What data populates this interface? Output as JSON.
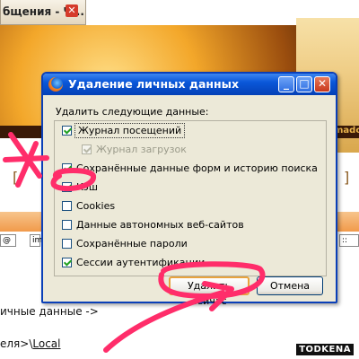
{
  "background": {
    "tab_title": "бщения - Ч...",
    "tab_close": "✕",
    "brand_fragment": "mado",
    "left_bracket": "[",
    "right_bracket": "]",
    "field_a": "@",
    "field_b": "im",
    "field_c": "::",
    "text_line_1": "ичные данные   ->",
    "text_line_2_prefix": "еля>\\",
    "text_line_2_link": "Local",
    "watermark": "TODKENA"
  },
  "dialog": {
    "title": "Удаление личных данных",
    "prompt": "Удалить следующие данные:",
    "options": [
      {
        "label": "Журнал посещений",
        "checked": true,
        "disabled": false
      },
      {
        "label": "Журнал загрузок",
        "checked": true,
        "disabled": true
      },
      {
        "label": "Сохранённые данные форм и историю поиска",
        "checked": true,
        "disabled": false
      },
      {
        "label": "Кэш",
        "checked": true,
        "disabled": false
      },
      {
        "label": "Cookies",
        "checked": false,
        "disabled": false
      },
      {
        "label": "Данные автономных веб-сайтов",
        "checked": false,
        "disabled": false
      },
      {
        "label": "Сохранённые пароли",
        "checked": false,
        "disabled": false
      },
      {
        "label": "Сессии аутентификации",
        "checked": true,
        "disabled": false
      }
    ],
    "buttons": {
      "delete": "Удалить сейчас",
      "cancel": "Отмена"
    }
  },
  "colors": {
    "titlebar": "#0a57d9",
    "annotation": "#ff2d6a",
    "checkmark": "#21a121"
  }
}
